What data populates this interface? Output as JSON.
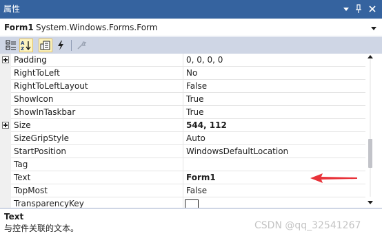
{
  "window": {
    "title": "属性",
    "buttons": {
      "dropdown": "▾",
      "pin": "🖈",
      "close": "✕"
    }
  },
  "object_selector": {
    "name": "Form1",
    "type": "System.Windows.Forms.Form"
  },
  "toolbar": {
    "buttons": [
      {
        "icon": "categorized-icon",
        "active": false
      },
      {
        "icon": "alphabetical-icon",
        "active": true
      },
      {
        "icon": "properties-icon",
        "active": true
      },
      {
        "icon": "events-icon",
        "active": false
      },
      {
        "icon": "property-pages-icon",
        "active": false
      }
    ]
  },
  "properties": [
    {
      "name": "Padding",
      "value": "0, 0, 0, 0",
      "expandable": true,
      "bold": false
    },
    {
      "name": "RightToLeft",
      "value": "No",
      "expandable": false,
      "bold": false
    },
    {
      "name": "RightToLeftLayout",
      "value": "False",
      "expandable": false,
      "bold": false
    },
    {
      "name": "ShowIcon",
      "value": "True",
      "expandable": false,
      "bold": false
    },
    {
      "name": "ShowInTaskbar",
      "value": "True",
      "expandable": false,
      "bold": false
    },
    {
      "name": "Size",
      "value": "544, 112",
      "expandable": true,
      "bold": true
    },
    {
      "name": "SizeGripStyle",
      "value": "Auto",
      "expandable": false,
      "bold": false
    },
    {
      "name": "StartPosition",
      "value": "WindowsDefaultLocation",
      "expandable": false,
      "bold": false
    },
    {
      "name": "Tag",
      "value": "",
      "expandable": false,
      "bold": false
    },
    {
      "name": "Text",
      "value": "Form1",
      "expandable": false,
      "bold": true
    },
    {
      "name": "TopMost",
      "value": "False",
      "expandable": false,
      "bold": false
    },
    {
      "name": "TransparencyKey",
      "value": "",
      "expandable": false,
      "bold": false,
      "swatch": "#ffffff"
    }
  ],
  "description": {
    "title": "Text",
    "text": "与控件关联的文本。"
  },
  "watermark": "CSDN @qq_32541267",
  "colors": {
    "titlebar": "#35639f",
    "toolbar": "#cfd6e5",
    "active_button": "#fdf4bf",
    "annotation_arrow": "#e8333a"
  },
  "scrollbar": {
    "position": 0.72
  }
}
